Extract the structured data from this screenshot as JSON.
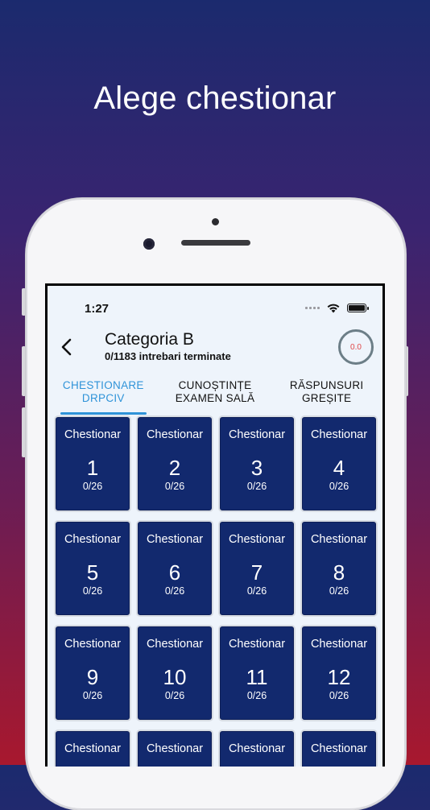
{
  "headline": "Alege chestionar",
  "status": {
    "time": "1:27"
  },
  "header": {
    "title": "Categoria B",
    "subtitle": "0/1183 intrebari terminate",
    "score": "0.0"
  },
  "tabs": [
    {
      "line1": "CHESTIONARE",
      "line2": "DRPCIV"
    },
    {
      "line1": "CUNOȘTINȚE",
      "line2": "EXAMEN SALĂ"
    },
    {
      "line1": "RĂSPUNSURI",
      "line2": "GREȘITE"
    }
  ],
  "cards": [
    {
      "label": "Chestionar",
      "number": "1",
      "progress": "0/26"
    },
    {
      "label": "Chestionar",
      "number": "2",
      "progress": "0/26"
    },
    {
      "label": "Chestionar",
      "number": "3",
      "progress": "0/26"
    },
    {
      "label": "Chestionar",
      "number": "4",
      "progress": "0/26"
    },
    {
      "label": "Chestionar",
      "number": "5",
      "progress": "0/26"
    },
    {
      "label": "Chestionar",
      "number": "6",
      "progress": "0/26"
    },
    {
      "label": "Chestionar",
      "number": "7",
      "progress": "0/26"
    },
    {
      "label": "Chestionar",
      "number": "8",
      "progress": "0/26"
    },
    {
      "label": "Chestionar",
      "number": "9",
      "progress": "0/26"
    },
    {
      "label": "Chestionar",
      "number": "10",
      "progress": "0/26"
    },
    {
      "label": "Chestionar",
      "number": "11",
      "progress": "0/26"
    },
    {
      "label": "Chestionar",
      "number": "12",
      "progress": "0/26"
    },
    {
      "label": "Chestionar",
      "number": "",
      "progress": ""
    },
    {
      "label": "Chestionar",
      "number": "",
      "progress": ""
    },
    {
      "label": "Chestionar",
      "number": "",
      "progress": ""
    },
    {
      "label": "Chestionar",
      "number": "",
      "progress": ""
    }
  ],
  "colors": {
    "accent": "#2f93d8",
    "card": "#12296e",
    "score": "#e04848"
  }
}
